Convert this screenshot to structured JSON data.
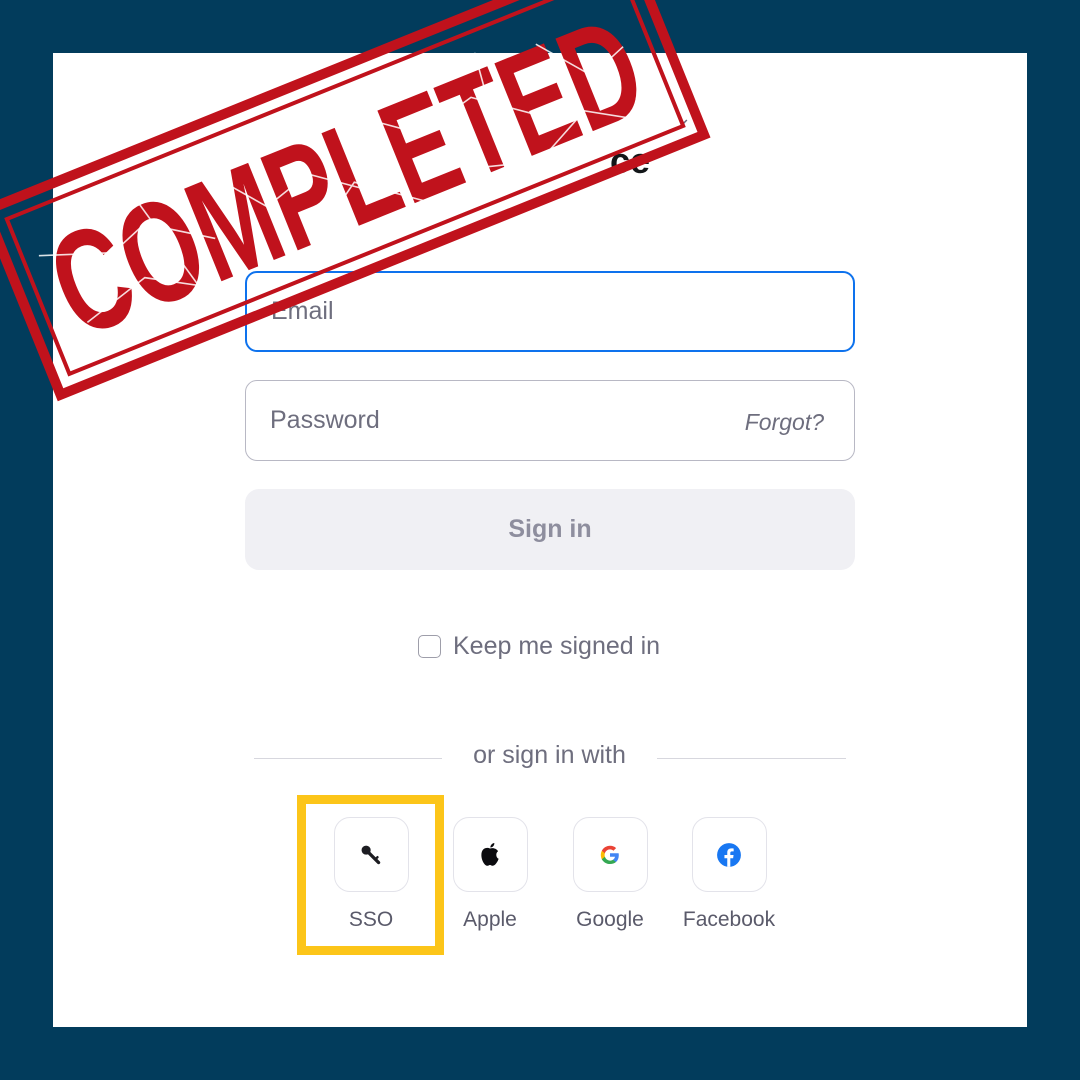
{
  "header": {
    "region_caret": "⌄",
    "title_fragment": "ce"
  },
  "form": {
    "email_placeholder": "Email",
    "password_placeholder": "Password",
    "forgot_label": "Forgot?",
    "signin_label": "Sign in",
    "keep_signed_in_label": "Keep me signed in"
  },
  "divider": {
    "label": "or sign in with"
  },
  "providers": [
    {
      "label": "SSO",
      "icon": "key-icon"
    },
    {
      "label": "Apple",
      "icon": "apple-icon"
    },
    {
      "label": "Google",
      "icon": "google-icon"
    },
    {
      "label": "Facebook",
      "icon": "facebook-icon"
    }
  ],
  "stamp": {
    "text": "COMPLETED",
    "color": "#c0121c"
  },
  "colors": {
    "background": "#023c5c",
    "accent": "#0e72ed",
    "highlight": "#fcc519",
    "facebook": "#1877f2"
  }
}
